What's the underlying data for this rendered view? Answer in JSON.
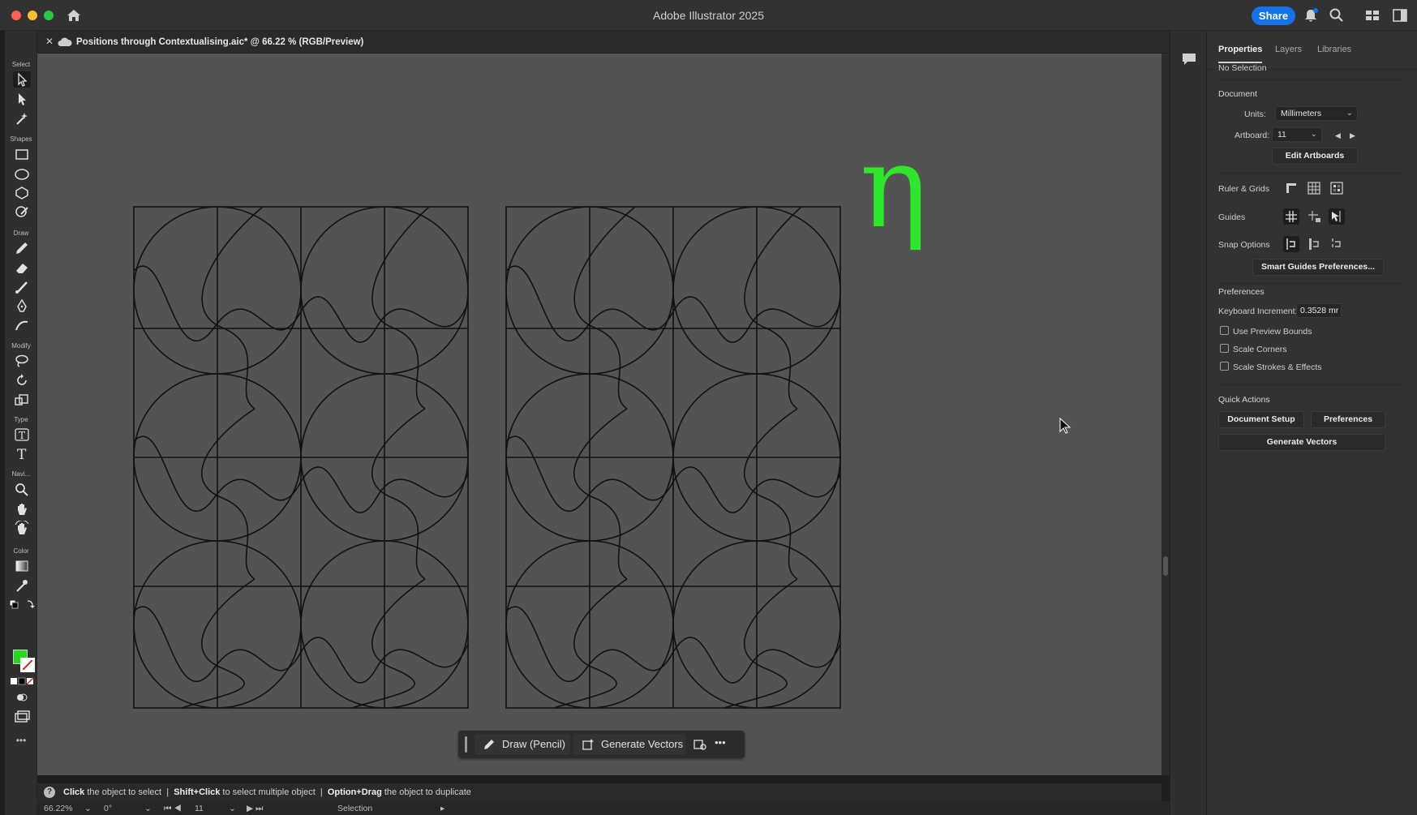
{
  "app": {
    "title": "Adobe Illustrator 2025",
    "share_label": "Share"
  },
  "document": {
    "tab_title": "Positions through Contextualising.aic* @ 66.22 % (RGB/Preview)",
    "glyph": "η"
  },
  "toolbar": {
    "groups": [
      "Select",
      "Shapes",
      "Draw",
      "Modify",
      "Type",
      "Navi...",
      "Color"
    ],
    "more": "•••"
  },
  "contextual_bar": {
    "draw_label": "Draw (Pencil)",
    "generate_label": "Generate Vectors",
    "more": "•••"
  },
  "hint": {
    "k1": "Click",
    "t1": "the object to select",
    "sep": "|",
    "k2": "Shift+Click",
    "t2": "to select multiple object",
    "k3": "Option+Drag",
    "t3": "the object to duplicate",
    "icon": "?"
  },
  "status": {
    "zoom": "66.22%",
    "rotation": "0°",
    "artboard": "11",
    "tool": "Selection"
  },
  "panel": {
    "tabs": [
      "Properties",
      "Layers",
      "Libraries"
    ],
    "selection": "No Selection",
    "document_heading": "Document",
    "units_label": "Units:",
    "units_value": "Millimeters",
    "artboard_label": "Artboard:",
    "artboard_value": "11",
    "edit_artboards": "Edit Artboards",
    "ruler_grids": "Ruler & Grids",
    "guides": "Guides",
    "snap_options": "Snap Options",
    "smart_guides_btn": "Smart Guides Preferences...",
    "preferences_heading": "Preferences",
    "keyboard_increment_label": "Keyboard Increment:",
    "keyboard_increment_value": "0.3528 mr",
    "checkboxes": [
      "Use Preview Bounds",
      "Scale Corners",
      "Scale Strokes & Effects"
    ],
    "quick_actions_heading": "Quick Actions",
    "document_setup": "Document Setup",
    "preferences_btn": "Preferences",
    "generate_vectors": "Generate Vectors"
  },
  "colors": {
    "fill": "#22d91e",
    "accent": "#1473e6",
    "glyph": "#2ee62a"
  }
}
